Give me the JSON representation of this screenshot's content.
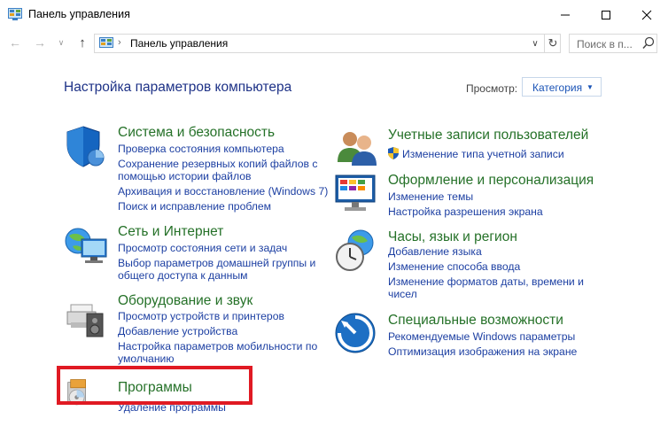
{
  "window": {
    "title": "Панель управления",
    "minimize_icon": "minimize-icon",
    "maximize_icon": "maximize-icon",
    "close_icon": "close-icon"
  },
  "navbar": {
    "address_path": "Панель управления",
    "search_placeholder": "Поиск в п..."
  },
  "content": {
    "heading": "Настройка параметров компьютера",
    "view_label": "Просмотр:",
    "view_value": "Категория"
  },
  "categories": [
    {
      "title": "Система и безопасность",
      "icon": "shield-icon",
      "links": [
        "Проверка состояния компьютера",
        "Сохранение резервных копий файлов с",
        "помощью истории файлов",
        "Архивация и восстановление (Windows 7)",
        "Поиск и исправление проблем"
      ]
    },
    {
      "title": "Сеть и Интернет",
      "icon": "network-globe-icon",
      "links": [
        "Просмотр состояния сети и задач",
        "Выбор параметров домашней группы и",
        "общего доступа к данным"
      ]
    },
    {
      "title": "Оборудование и звук",
      "icon": "printer-icon",
      "links": [
        "Просмотр устройств и принтеров",
        "Добавление устройства",
        "Настройка параметров мобильности по",
        "умолчанию"
      ]
    },
    {
      "title": "Программы",
      "icon": "programs-disc-icon",
      "links": [
        "Удаление программы"
      ]
    },
    {
      "title": "Учетные записи пользователей",
      "icon": "users-icon",
      "links": [
        "Изменение типа учетной записи"
      ]
    },
    {
      "title": "Оформление и персонализация",
      "icon": "monitor-icon",
      "links": [
        "Изменение темы",
        "Настройка разрешения экрана"
      ]
    },
    {
      "title": "Часы, язык и регион",
      "icon": "clock-globe-icon",
      "links": [
        "Добавление языка",
        "Изменение способа ввода",
        "Изменение форматов даты, времени и",
        "чисел"
      ]
    },
    {
      "title": "Специальные возможности",
      "icon": "accessibility-icon",
      "links": [
        "Рекомендуемые Windows параметры",
        "Оптимизация изображения на экране"
      ]
    }
  ],
  "colors": {
    "heading": "#1e3287",
    "category_title": "#257128",
    "link": "#1c3fa2",
    "highlight_box": "#e01a23"
  }
}
